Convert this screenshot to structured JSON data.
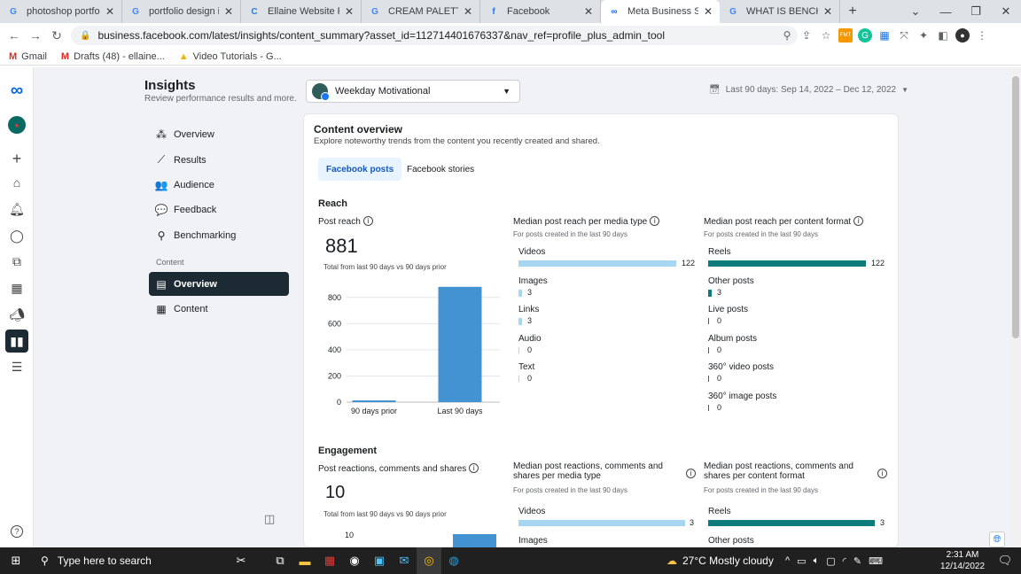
{
  "browser": {
    "tabs": [
      {
        "title": "photoshop portfolio",
        "icon": "G",
        "color": "#4285f4"
      },
      {
        "title": "portfolio design ideas",
        "icon": "G",
        "color": "#4285f4"
      },
      {
        "title": "Ellaine Website Portfo",
        "icon": "C",
        "color": "#2d7de0"
      },
      {
        "title": "CREAM PALETTE CODE",
        "icon": "G",
        "color": "#4285f4"
      },
      {
        "title": "Facebook",
        "icon": "f",
        "color": "#1877f2"
      },
      {
        "title": "Meta Business Suite",
        "icon": "∞",
        "color": "#0668e1"
      },
      {
        "title": "WHAT IS BENCHMARK",
        "icon": "G",
        "color": "#4285f4"
      }
    ],
    "url": "business.facebook.com/latest/insights/content_summary?asset_id=112714401676337&nav_ref=profile_plus_admin_tool",
    "bookmarks": [
      {
        "label": "Gmail",
        "icon": "M",
        "color": "#d93025"
      },
      {
        "label": "Drafts (48) - ellaine...",
        "icon": "M",
        "color": "#d93025"
      },
      {
        "label": "Video Tutorials - G...",
        "icon": "▲",
        "color": "#f4b400"
      }
    ]
  },
  "header": {
    "title": "Insights",
    "subtitle": "Review performance results and more.",
    "account": "Weekday Motivational",
    "date_range": "Last 90 days: Sep 14, 2022 – Dec 12, 2022"
  },
  "nav": {
    "items": [
      {
        "label": "Overview",
        "icon": "⁂"
      },
      {
        "label": "Results",
        "icon": "⟋"
      },
      {
        "label": "Audience",
        "icon": "👥"
      },
      {
        "label": "Feedback",
        "icon": "💬"
      },
      {
        "label": "Benchmarking",
        "icon": "⚲"
      }
    ],
    "section": "Content",
    "sub_items": [
      {
        "label": "Overview",
        "icon": "▤"
      },
      {
        "label": "Content",
        "icon": "▦"
      }
    ]
  },
  "content": {
    "title": "Content overview",
    "subtitle": "Explore noteworthy trends from the content you recently created and shared.",
    "tabs": [
      "Facebook posts",
      "Facebook stories"
    ],
    "reach": {
      "heading": "Reach",
      "label": "Post reach",
      "value": "881",
      "note": "Total from last 90 days vs 90 days prior",
      "media_title": "Median post reach per media type",
      "media_sub": "For posts created in the last 90 days",
      "format_title": "Median post reach per content format",
      "format_sub": "For posts created in the last 90 days"
    },
    "engagement": {
      "heading": "Engagement",
      "label": "Post reactions, comments and shares",
      "value": "10",
      "note": "Total from last 90 days vs 90 days prior",
      "media_title": "Median post reactions, comments and shares per media type",
      "media_sub": "For posts created in the last 90 days",
      "format_title": "Median post reactions, comments and shares per content format",
      "format_sub": "For posts created in the last 90 days",
      "axis_top": "10",
      "media_rows": [
        {
          "label": "Videos",
          "value": "3"
        },
        {
          "label": "Images",
          "value": ""
        }
      ],
      "format_rows": [
        {
          "label": "Reels",
          "value": "3"
        },
        {
          "label": "Other posts",
          "value": ""
        }
      ]
    }
  },
  "chart_data": [
    {
      "type": "bar",
      "categories": [
        "90 days prior",
        "Last 90 days"
      ],
      "values": [
        12,
        881
      ],
      "ylim": [
        0,
        900
      ],
      "yticks": [
        0,
        200,
        400,
        600,
        800
      ],
      "color": "#4393d3"
    },
    {
      "type": "bar",
      "orientation": "horizontal",
      "categories": [
        "Videos",
        "Images",
        "Links",
        "Audio",
        "Text"
      ],
      "values": [
        122,
        3,
        3,
        0,
        0
      ],
      "xlim": [
        0,
        122
      ],
      "color": "#a7d6f2"
    },
    {
      "type": "bar",
      "orientation": "horizontal",
      "categories": [
        "Reels",
        "Other posts",
        "Live posts",
        "Album posts",
        "360° video posts",
        "360° image posts"
      ],
      "values": [
        122,
        3,
        0,
        0,
        0,
        0
      ],
      "xlim": [
        0,
        122
      ],
      "color": "#0e7c7b"
    }
  ],
  "taskbar": {
    "search_placeholder": "Type here to search",
    "weather": "27°C  Mostly cloudy",
    "time": "2:31 AM",
    "date": "12/14/2022"
  }
}
